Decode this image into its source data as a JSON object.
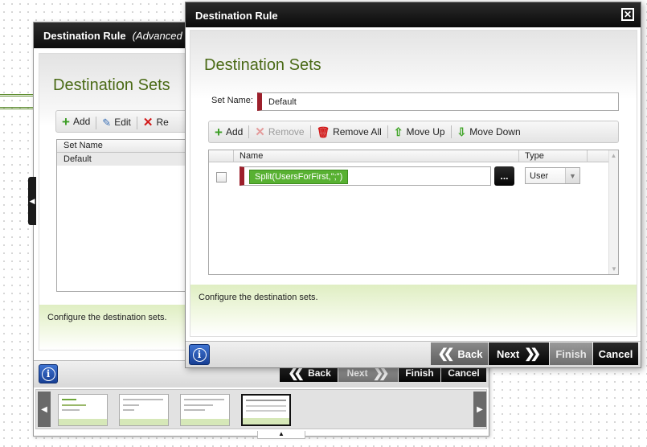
{
  "back_window": {
    "title": "Destination Rule",
    "subtitle": "(Advanced",
    "section_title": "Destination Sets",
    "toolbar": {
      "add": "Add",
      "edit": "Edit",
      "remove_partial": "Re"
    },
    "list_header": "Set Name",
    "list_items": [
      "Default"
    ],
    "hint": "Configure the destination sets.",
    "buttons": {
      "back": "Back",
      "next": "Next",
      "finish": "Finish",
      "cancel": "Cancel"
    },
    "info": "i"
  },
  "dialog": {
    "title": "Destination Rule",
    "close_glyph": "✕",
    "section_title": "Destination Sets",
    "set_name_label": "Set Name:",
    "set_name_value": "Default",
    "toolbar": {
      "add": "Add",
      "remove": "Remove",
      "remove_all": "Remove All",
      "move_up": "Move Up",
      "move_down": "Move Down"
    },
    "grid_headers": {
      "name": "Name",
      "type": "Type"
    },
    "rows": [
      {
        "expression": "Split(UsersForFirst,\";\")",
        "ellipsis": "...",
        "type": "User"
      }
    ],
    "hint": "Configure the destination sets.",
    "buttons": {
      "back": "Back",
      "next": "Next",
      "finish": "Finish",
      "cancel": "Cancel"
    },
    "info": "i"
  },
  "colors": {
    "title_bar": "#111111",
    "section_title": "#4a6a16",
    "hint_green": "#dfeec2",
    "expression_tag": "#58b132",
    "required_marker": "#9c1f2b",
    "info_button": "#2a5bbf"
  }
}
